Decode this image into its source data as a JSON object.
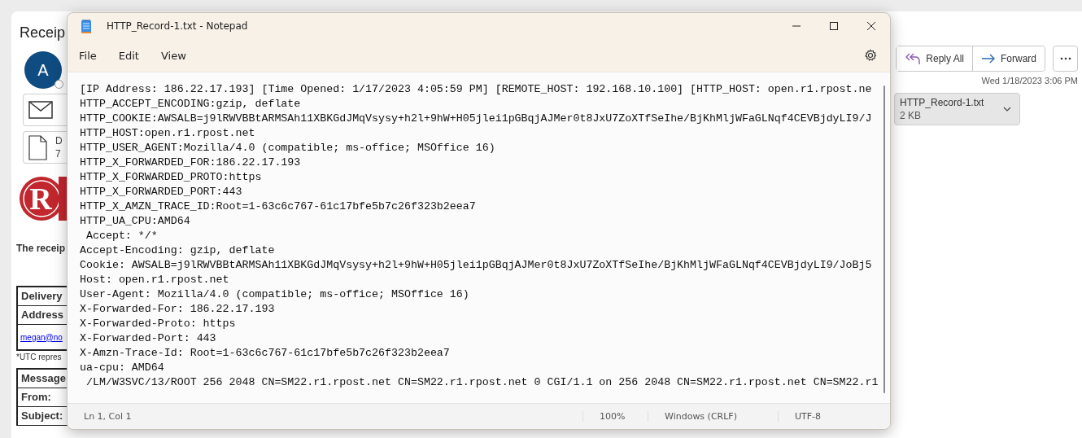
{
  "email": {
    "subject": "Receip",
    "avatar_initial": "A",
    "cards": [
      {
        "kind": "message"
      },
      {
        "kind": "document",
        "line_1": "D",
        "line_2": "7"
      }
    ],
    "logo_letter": "R",
    "intro": "The receip",
    "delivery_table": {
      "rows": [
        "Delivery",
        "Address"
      ],
      "link": "megan@no"
    },
    "footnote": "*UTC repres",
    "message_table": {
      "rows": [
        "Message",
        "From:",
        "Subject:"
      ]
    },
    "actions": [
      {
        "kind": "reply-all",
        "label": "Reply All"
      },
      {
        "kind": "forward",
        "label": "Forward"
      }
    ],
    "date": "Wed 1/18/2023 3:06 PM",
    "attachment": {
      "name": "HTTP_Record-1.txt",
      "size": "2 KB"
    }
  },
  "notepad": {
    "title": "HTTP_Record-1.txt - Notepad",
    "menu": [
      "File",
      "Edit",
      "View"
    ],
    "lines": [
      "[IP Address: 186.22.17.193] [Time Opened: 1/17/2023 4:05:59 PM] [REMOTE_HOST: 192.168.10.100] [HTTP_HOST: open.r1.rpost.ne",
      "HTTP_ACCEPT_ENCODING:gzip, deflate",
      "HTTP_COOKIE:AWSALB=j9lRWVBBtARMSAh11XBKGdJMqVsysy+h2l+9hW+H05jlei1pGBqjAJMer0t8JxU7ZoXTfSeIhe/BjKhMljWFaGLNqf4CEVBjdyLI9/J",
      "HTTP_HOST:open.r1.rpost.net",
      "HTTP_USER_AGENT:Mozilla/4.0 (compatible; ms-office; MSOffice 16)",
      "HTTP_X_FORWARDED_FOR:186.22.17.193",
      "HTTP_X_FORWARDED_PROTO:https",
      "HTTP_X_FORWARDED_PORT:443",
      "HTTP_X_AMZN_TRACE_ID:Root=1-63c6c767-61c17bfe5b7c26f323b2eea7",
      "HTTP_UA_CPU:AMD64",
      " Accept: */*",
      "Accept-Encoding: gzip, deflate",
      "Cookie: AWSALB=j9lRWVBBtARMSAh11XBKGdJMqVsysy+h2l+9hW+H05jlei1pGBqjAJMer0t8JxU7ZoXTfSeIhe/BjKhMljWFaGLNqf4CEVBjdyLI9/JoBj5",
      "Host: open.r1.rpost.net",
      "User-Agent: Mozilla/4.0 (compatible; ms-office; MSOffice 16)",
      "X-Forwarded-For: 186.22.17.193",
      "X-Forwarded-Proto: https",
      "X-Forwarded-Port: 443",
      "X-Amzn-Trace-Id: Root=1-63c6c767-61c17bfe5b7c26f323b2eea7",
      "ua-cpu: AMD64",
      " /LM/W3SVC/13/ROOT 256 2048 CN=SM22.r1.rpost.net CN=SM22.r1.rpost.net 0 CGI/1.1 on 256 2048 CN=SM22.r1.rpost.net CN=SM22.r1"
    ],
    "status_bar": [
      "Ln 1, Col 1",
      "100%",
      "Windows (CRLF)",
      "UTF-8"
    ]
  }
}
